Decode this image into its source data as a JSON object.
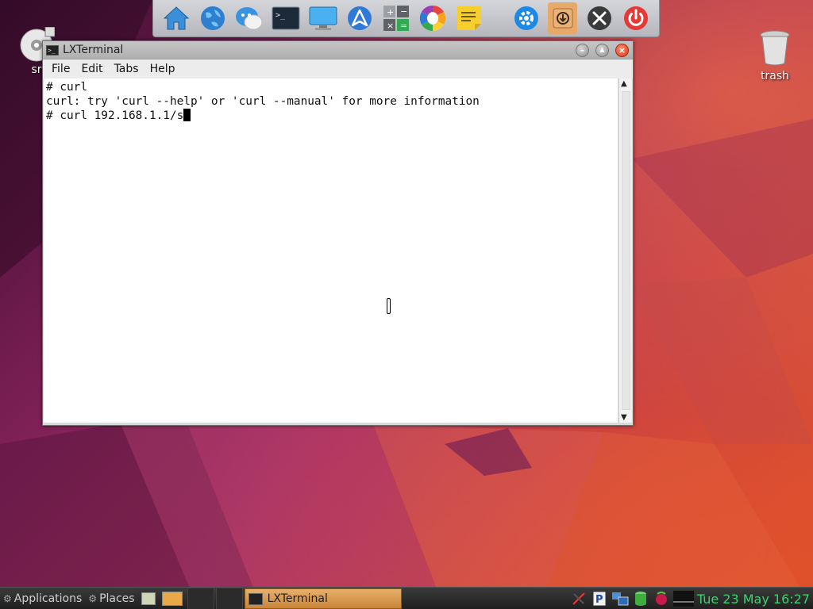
{
  "dock": {
    "items": [
      {
        "name": "home-icon"
      },
      {
        "name": "web-browser-icon"
      },
      {
        "name": "chat-icon"
      },
      {
        "name": "terminal-icon"
      },
      {
        "name": "display-icon"
      },
      {
        "name": "launcher-icon"
      },
      {
        "name": "calculator-icon"
      },
      {
        "name": "color-wheel-icon"
      },
      {
        "name": "notes-icon"
      },
      {
        "name": "settings-icon"
      },
      {
        "name": "download-icon"
      },
      {
        "name": "tools-icon"
      },
      {
        "name": "power-icon"
      }
    ]
  },
  "desktop": {
    "left_icon_label": "sr",
    "trash_label": "trash"
  },
  "window": {
    "title": "LXTerminal",
    "menu": [
      "File",
      "Edit",
      "Tabs",
      "Help"
    ]
  },
  "terminal": {
    "lines": [
      "# curl",
      "curl: try 'curl --help' or 'curl --manual' for more information",
      "# curl 192.168.1.1/s"
    ]
  },
  "taskbar": {
    "applications_label": "Applications",
    "places_label": "Places",
    "task_label": "LXTerminal",
    "clock": "Tue 23 May 16:27"
  },
  "colors": {
    "clock": "#39d36b",
    "active_task": "#d9973f",
    "close_button": "#d93b1e"
  }
}
